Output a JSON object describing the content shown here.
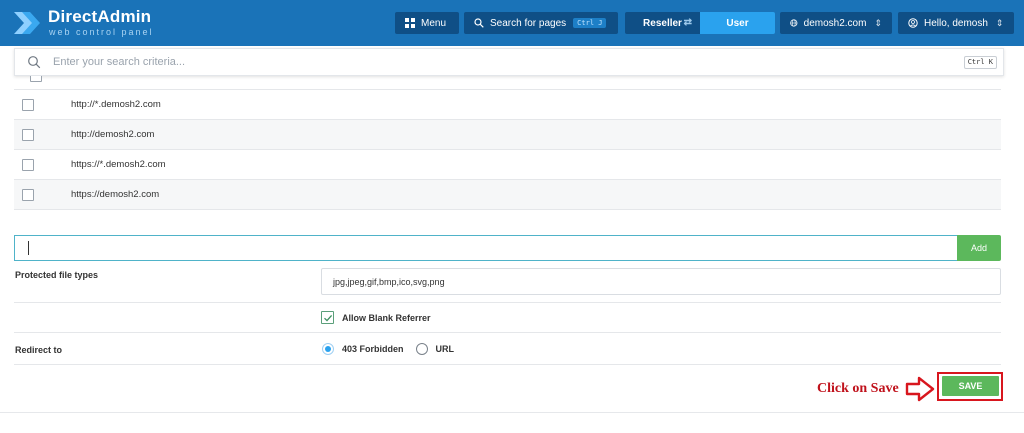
{
  "header": {
    "brand_title": "DirectAdmin",
    "brand_subtitle": "web control panel",
    "menu_label": "Menu",
    "search_pages_label": "Search for pages",
    "search_pages_shortcut": "Ctrl J",
    "role_reseller": "Reseller",
    "role_user": "User",
    "domain_label": "demosh2.com",
    "greeting": "Hello, demosh"
  },
  "search": {
    "placeholder": "Enter your search criteria...",
    "shortcut": "Ctrl K"
  },
  "url_rows": [
    "http://*.demosh2.com",
    "http://demosh2.com",
    "https://*.demosh2.com",
    "https://demosh2.com"
  ],
  "add_form": {
    "button_label": "Add"
  },
  "protected_file_types": {
    "label": "Protected file types",
    "value": "jpg,jpeg,gif,bmp,ico,svg,png"
  },
  "allow_blank_referrer": {
    "label": "Allow Blank Referrer",
    "checked": true
  },
  "redirect": {
    "label": "Redirect to",
    "options": [
      "403 Forbidden",
      "URL"
    ],
    "selected": "403 Forbidden"
  },
  "annotation": {
    "text": "Click on Save"
  },
  "save_button": {
    "label": "SAVE"
  },
  "colors": {
    "header_bg": "#1a73b8",
    "accent_blue": "#2aa2ee",
    "success_green": "#5cb85c",
    "annotation_red": "#d8161e"
  }
}
